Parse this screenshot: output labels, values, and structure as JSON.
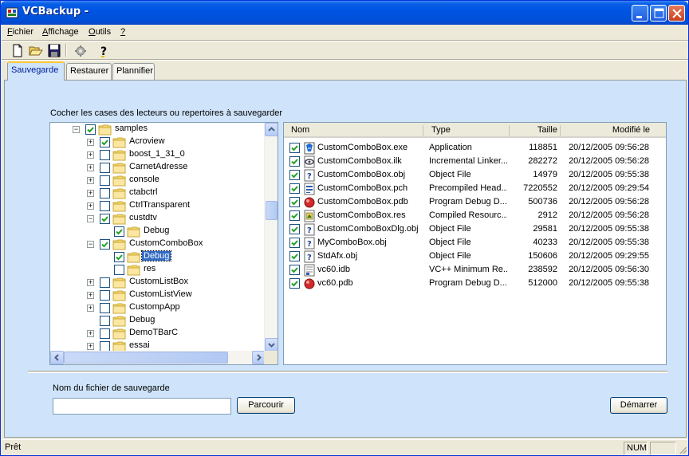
{
  "window": {
    "title": "VCBackup -"
  },
  "menu": [
    {
      "pre": "",
      "ul": "F",
      "post": "ichier"
    },
    {
      "pre": "",
      "ul": "A",
      "post": "ffichage"
    },
    {
      "pre": "",
      "ul": "O",
      "post": "utils"
    },
    {
      "pre": "",
      "ul": "?",
      "post": ""
    }
  ],
  "toolbar": [
    "new-file-icon",
    "open-folder-icon",
    "save-icon",
    "settings-icon",
    "help-icon"
  ],
  "tabs": [
    "Sauvegarde",
    "Restaurer",
    "Plannifier"
  ],
  "instruction": "Cocher les cases des lecteurs ou repertoires à sauvegarder",
  "tree": [
    {
      "label": "samples",
      "level": 0,
      "expander": "−",
      "checked": true
    },
    {
      "label": "Acroview",
      "level": 1,
      "expander": "+",
      "checked": true
    },
    {
      "label": "boost_1_31_0",
      "level": 1,
      "expander": "+",
      "checked": false
    },
    {
      "label": "CarnetAdresse",
      "level": 1,
      "expander": "+",
      "checked": false
    },
    {
      "label": "console",
      "level": 1,
      "expander": "+",
      "checked": false
    },
    {
      "label": "ctabctrl",
      "level": 1,
      "expander": "+",
      "checked": false
    },
    {
      "label": "CtrlTransparent",
      "level": 1,
      "expander": "+",
      "checked": false
    },
    {
      "label": "custdtv",
      "level": 1,
      "expander": "−",
      "checked": true
    },
    {
      "label": "Debug",
      "level": 2,
      "expander": "",
      "checked": true
    },
    {
      "label": "CustomComboBox",
      "level": 1,
      "expander": "−",
      "checked": true
    },
    {
      "label": "Debug",
      "level": 2,
      "expander": "",
      "checked": true,
      "selected": true
    },
    {
      "label": "res",
      "level": 2,
      "expander": "",
      "checked": false
    },
    {
      "label": "CustomListBox",
      "level": 1,
      "expander": "+",
      "checked": false
    },
    {
      "label": "CustomListView",
      "level": 1,
      "expander": "+",
      "checked": false
    },
    {
      "label": "CustompApp",
      "level": 1,
      "expander": "+",
      "checked": false
    },
    {
      "label": "Debug",
      "level": 1,
      "expander": "",
      "checked": false
    },
    {
      "label": "DemoTBarC",
      "level": 1,
      "expander": "+",
      "checked": false
    },
    {
      "label": "essai",
      "level": 1,
      "expander": "+",
      "checked": false
    }
  ],
  "list": {
    "columns": [
      "Nom",
      "Type",
      "Taille",
      "Modifié le"
    ],
    "rows": [
      {
        "name": "CustomComboBox.exe",
        "type": "Application",
        "size": "118851",
        "date": "20/12/2005 09:56:28",
        "icon": "exe-icon"
      },
      {
        "name": "CustomComboBox.ilk",
        "type": "Incremental Linker...",
        "size": "282272",
        "date": "20/12/2005 09:56:28",
        "icon": "ilk-icon"
      },
      {
        "name": "CustomComboBox.obj",
        "type": "Object File",
        "size": "14979",
        "date": "20/12/2005 09:55:38",
        "icon": "obj-icon"
      },
      {
        "name": "CustomComboBox.pch",
        "type": "Precompiled Head...",
        "size": "7220552",
        "date": "20/12/2005 09:29:54",
        "icon": "pch-icon"
      },
      {
        "name": "CustomComboBox.pdb",
        "type": "Program Debug D...",
        "size": "500736",
        "date": "20/12/2005 09:56:28",
        "icon": "pdb-icon"
      },
      {
        "name": "CustomComboBox.res",
        "type": "Compiled Resourc...",
        "size": "2912",
        "date": "20/12/2005 09:56:28",
        "icon": "res-icon"
      },
      {
        "name": "CustomComboBoxDlg.obj",
        "type": "Object File",
        "size": "29581",
        "date": "20/12/2005 09:55:38",
        "icon": "obj-icon"
      },
      {
        "name": "MyComboBox.obj",
        "type": "Object File",
        "size": "40233",
        "date": "20/12/2005 09:55:38",
        "icon": "obj-icon"
      },
      {
        "name": "StdAfx.obj",
        "type": "Object File",
        "size": "150606",
        "date": "20/12/2005 09:29:55",
        "icon": "obj-icon"
      },
      {
        "name": "vc60.idb",
        "type": "VC++ Minimum Re...",
        "size": "238592",
        "date": "20/12/2005 09:56:30",
        "icon": "idb-icon"
      },
      {
        "name": "vc60.pdb",
        "type": "Program Debug D...",
        "size": "512000",
        "date": "20/12/2005 09:55:38",
        "icon": "pdb-icon"
      }
    ]
  },
  "backup": {
    "filename_label": "Nom du fichier de sauvegarde",
    "filename_value": "",
    "browse_label": "Parcourir",
    "start_label": "Démarrer"
  },
  "status": {
    "text": "Prêt",
    "num": "NUM"
  }
}
